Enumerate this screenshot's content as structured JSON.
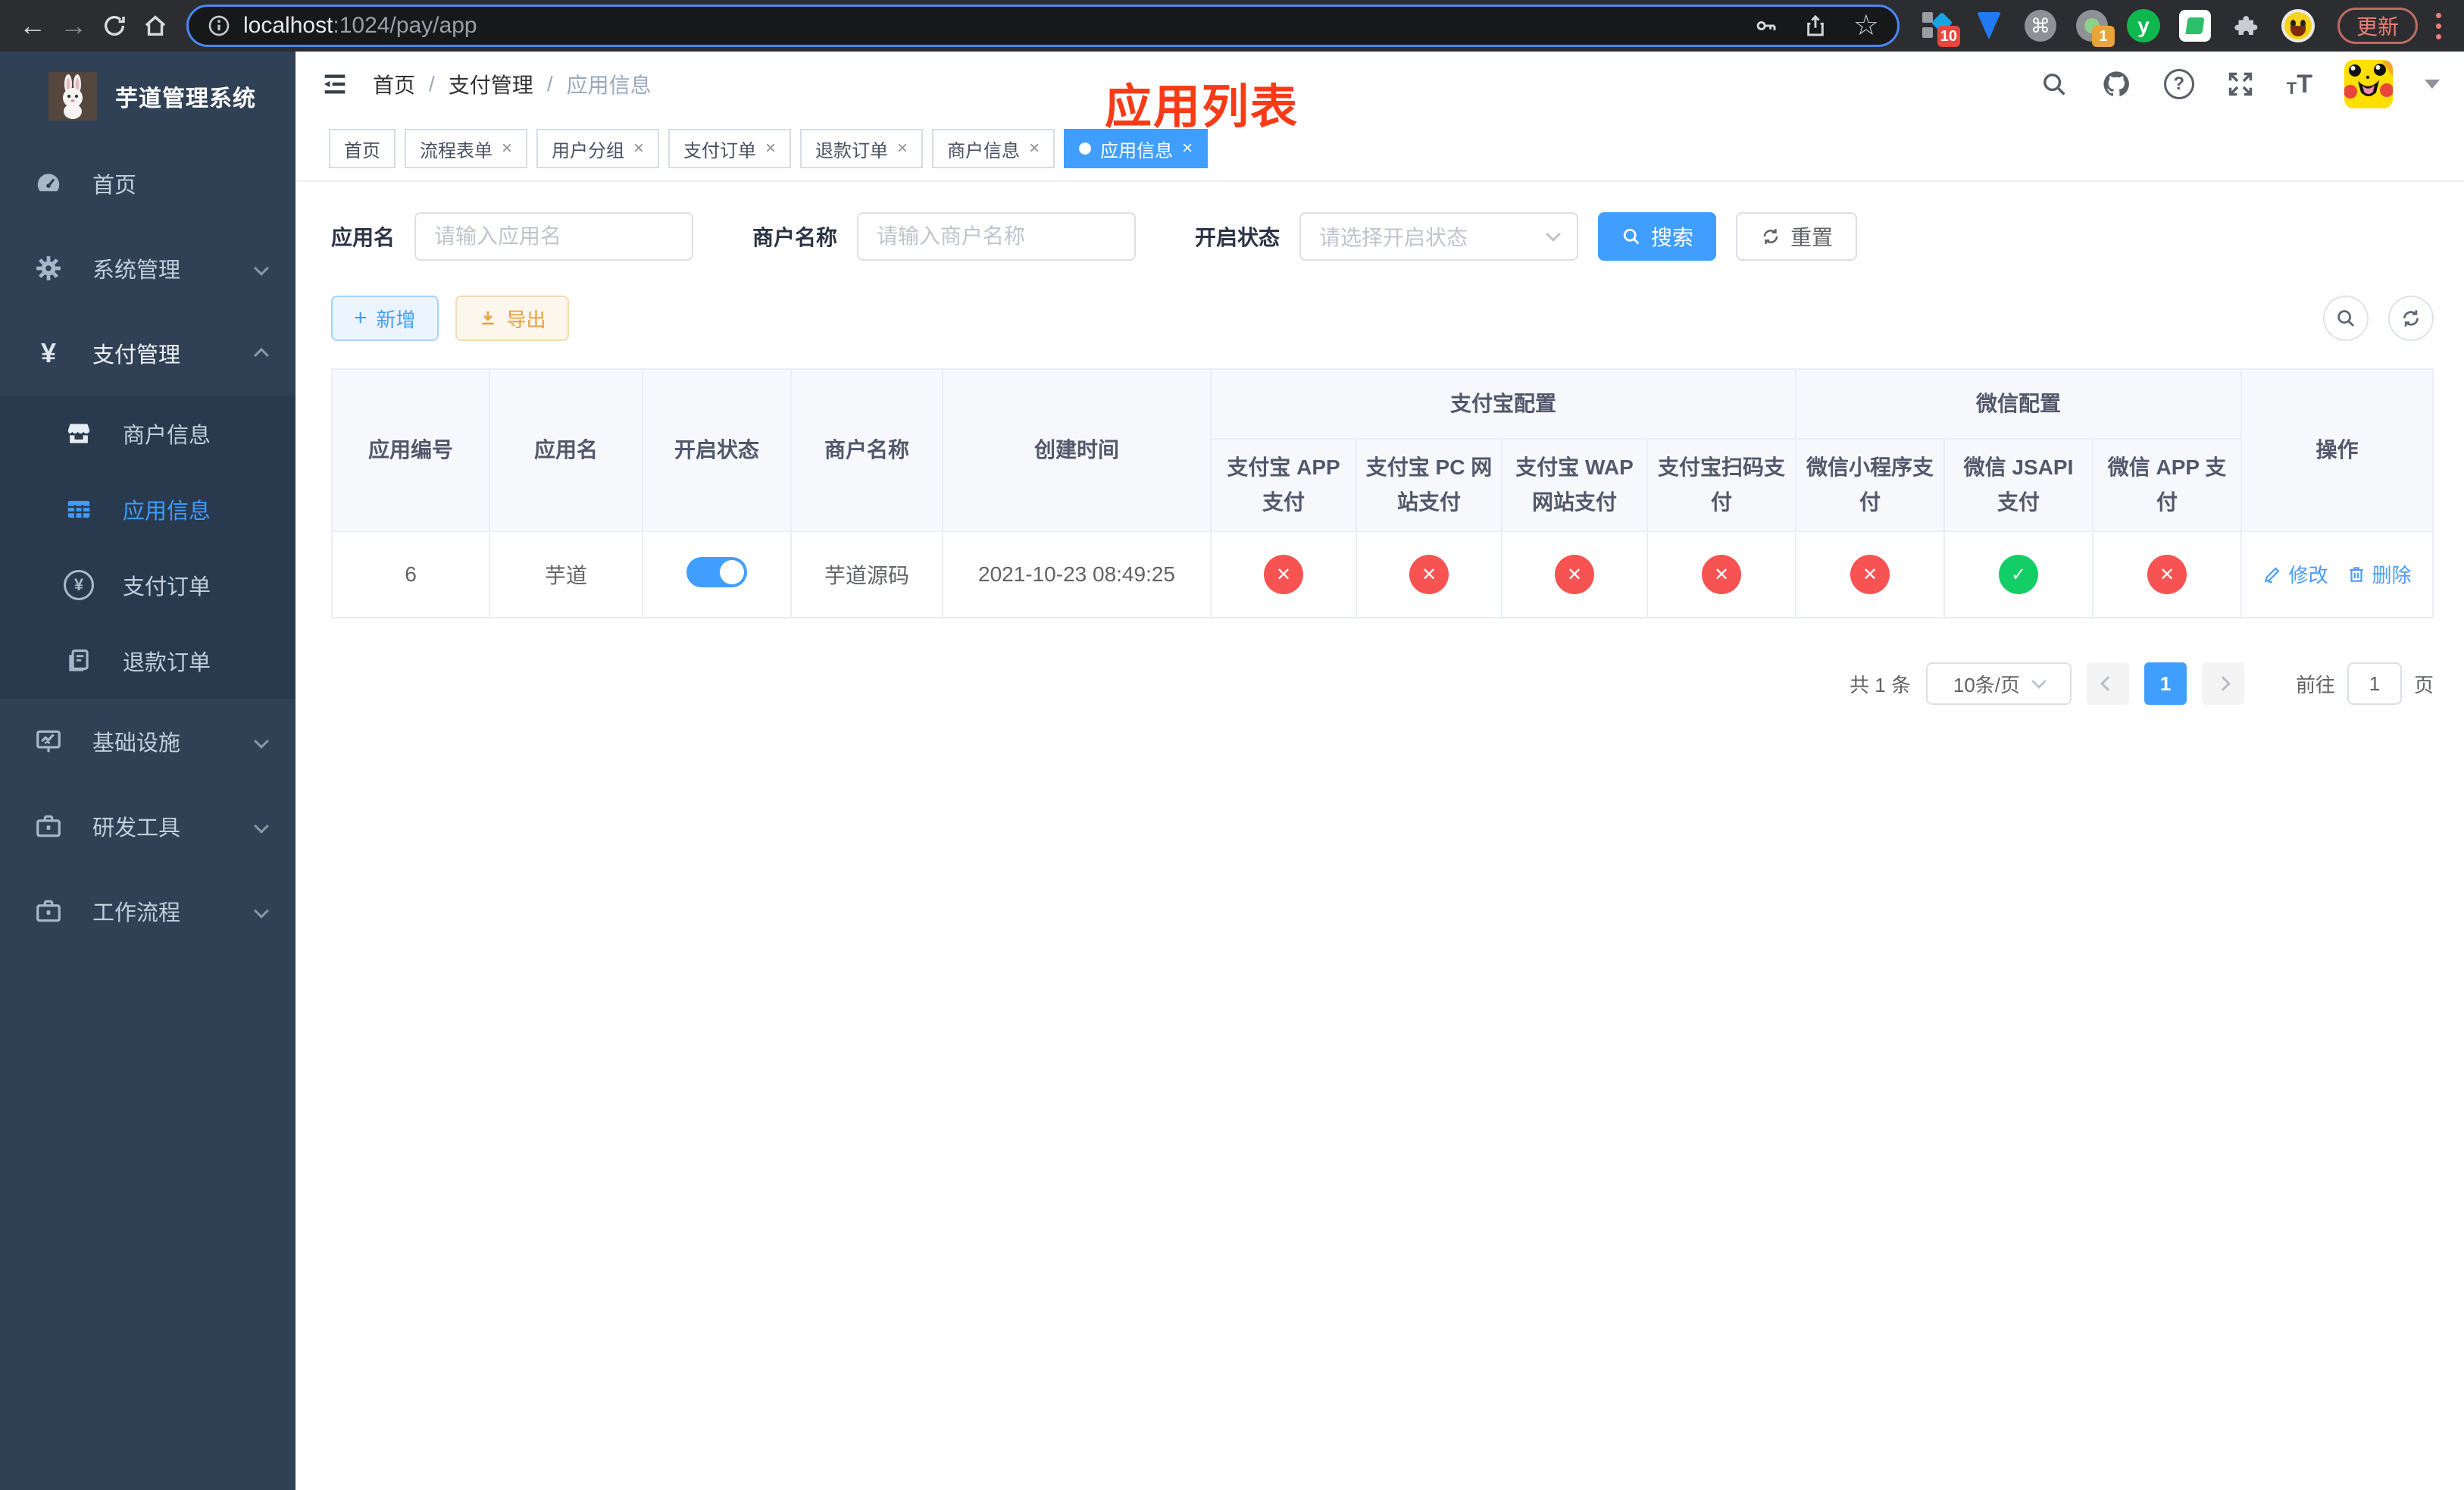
{
  "browser": {
    "url_host": "localhost",
    "url_path": ":1024/pay/app",
    "update_label": "更新",
    "ext_badge_sketch": "10",
    "ext_badge_record": "1",
    "ext_y_label": "y"
  },
  "sidebar": {
    "title": "芋道管理系统",
    "items": [
      {
        "label": "首页"
      },
      {
        "label": "系统管理"
      },
      {
        "label": "支付管理",
        "children": [
          {
            "label": "商户信息"
          },
          {
            "label": "应用信息"
          },
          {
            "label": "支付订单"
          },
          {
            "label": "退款订单"
          }
        ]
      },
      {
        "label": "基础设施"
      },
      {
        "label": "研发工具"
      },
      {
        "label": "工作流程"
      }
    ]
  },
  "header": {
    "breadcrumb": {
      "items": [
        "首页",
        "支付管理",
        "应用信息"
      ],
      "separator": "/"
    },
    "annotation": "应用列表"
  },
  "tabs": {
    "items": [
      {
        "label": "首页"
      },
      {
        "label": "流程表单"
      },
      {
        "label": "用户分组"
      },
      {
        "label": "支付订单"
      },
      {
        "label": "退款订单"
      },
      {
        "label": "商户信息"
      },
      {
        "label": "应用信息"
      }
    ]
  },
  "filters": {
    "fields": [
      {
        "label": "应用名",
        "placeholder": "请输入应用名"
      },
      {
        "label": "商户名称",
        "placeholder": "请输入商户名称"
      },
      {
        "label": "开启状态",
        "placeholder": "请选择开启状态"
      }
    ],
    "search_label": "搜索",
    "reset_label": "重置"
  },
  "toolbar": {
    "add_label": "新增",
    "export_label": "导出"
  },
  "table": {
    "columns": [
      "应用编号",
      "应用名",
      "开启状态",
      "商户名称",
      "创建时间"
    ],
    "groups": [
      {
        "label": "支付宝配置",
        "children": [
          "支付宝 APP 支付",
          "支付宝 PC 网站支付",
          "支付宝 WAP 网站支付",
          "支付宝扫码支付"
        ]
      },
      {
        "label": "微信配置",
        "children": [
          "微信小程序支付",
          "微信 JSAPI 支付",
          "微信 APP 支付"
        ]
      }
    ],
    "actions_label": "操作",
    "rows": [
      {
        "app_id": "6",
        "app_name": "芋道",
        "enabled": true,
        "merchant_name": "芋道源码",
        "created_at": "2021-10-23 08:49:25",
        "channels": [
          "no",
          "no",
          "no",
          "no",
          "no",
          "yes",
          "no"
        ],
        "edit_label": "修改",
        "delete_label": "删除"
      }
    ]
  },
  "pagination": {
    "total_label": "共 1 条",
    "page_size_label": "10条/页",
    "current_page": "1",
    "goto_label": "前往",
    "goto_value": "1",
    "page_unit_label": "页"
  },
  "icons": {
    "close": "×",
    "check": "✓",
    "cross": "✕",
    "back": "←",
    "forward": "→",
    "star": "☆",
    "command": "⌘",
    "question": "?",
    "plus": "+",
    "yen": "¥",
    "font_small": "T",
    "font_large": "T"
  },
  "colors": {
    "primary": "#409eff",
    "success": "#13ce66",
    "danger": "#f65352",
    "annotation": "#f93a17",
    "sidebar_bg": "#304156"
  }
}
